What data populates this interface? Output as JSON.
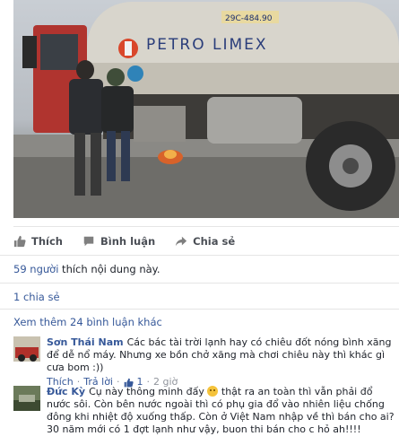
{
  "photo": {
    "truck_brand": "PETRO LIMEX",
    "truck_plate": "29C-484.90"
  },
  "actions": {
    "like": "Thích",
    "comment": "Bình luận",
    "share": "Chia sẻ"
  },
  "likes": {
    "count_text": "59 người",
    "rest": " thích nội dung này."
  },
  "shares": "1 chia sẻ",
  "more_comments": "Xem thêm 24 bình luận khác",
  "comments": [
    {
      "name": "Sơn Thái Nam",
      "text": "Các bác tài trời lạnh hay có chiêu đốt nóng bình xăng để dễ nổ máy. Nhưng xe bồn chở xăng mà chơi chiêu này thì khác gì cưa bom :))",
      "like_label": "Thích",
      "reply_label": "Trả lời",
      "like_count": "1",
      "time": "2 giờ"
    },
    {
      "name": "Đức Kỳ",
      "text_before": "Cụ này thông minh đấy",
      "text_after": "thật ra an toàn thì vẫn phải đổ nước sôi. Còn bên nước ngoài thì có phụ gia đổ vào nhiên liệu chống đông khi nhiệt độ xuống thấp. Còn ở Việt Nam nhập về thì bán cho ai? 30 năm mới có 1 đợt lạnh như vậy, buon thi bán cho c hỏ ah!!!!"
    }
  ],
  "colors": {
    "link": "#365899",
    "text": "#1d2129",
    "muted": "#90949c",
    "action": "#4b4f56"
  }
}
